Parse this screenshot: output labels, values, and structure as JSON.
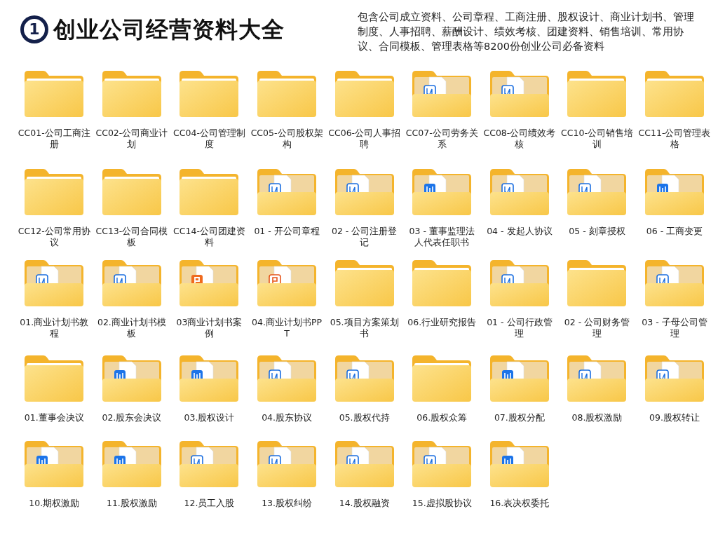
{
  "header": {
    "badge": "1",
    "title": "创业公司经营资料大全",
    "description": "包含公司成立资料、公司章程、工商注册、股权设计、商业计划书、管理制度、人事招聘、薪酬设计、绩效考核、团建资料、销售培训、常用协议、合同模板、管理表格等8200份创业公司必备资料"
  },
  "rows": [
    [
      {
        "name": "CC01-公司工商注册",
        "kind": "empty"
      },
      {
        "name": "CC02-公司商业计划",
        "kind": "empty"
      },
      {
        "name": "CC04-公司管理制度",
        "kind": "empty"
      },
      {
        "name": "CC05-公司股权架构",
        "kind": "empty"
      },
      {
        "name": "CC06-公司人事招聘",
        "kind": "empty"
      },
      {
        "name": "CC07-公司劳务关系",
        "kind": "doc-outline"
      },
      {
        "name": "CC08-公司绩效考核",
        "kind": "doc-outline"
      },
      {
        "name": "CC10-公司销售培训",
        "kind": "empty"
      },
      {
        "name": "CC11-公司管理表格",
        "kind": "empty"
      }
    ],
    [
      {
        "name": "CC12-公司常用协议",
        "kind": "empty"
      },
      {
        "name": "CC13-公司合同模板",
        "kind": "empty"
      },
      {
        "name": "CC14-公司团建资料",
        "kind": "empty"
      },
      {
        "name": "01 - 开公司章程",
        "kind": "doc-outline"
      },
      {
        "name": "02 - 公司注册登记",
        "kind": "doc-outline"
      },
      {
        "name": "03 - 董事监理法人代表任职书",
        "kind": "doc-filled"
      },
      {
        "name": "04 - 发起人协议",
        "kind": "doc-outline"
      },
      {
        "name": "05 - 刻章授权",
        "kind": "doc-outline"
      },
      {
        "name": "06 - 工商变更",
        "kind": "doc-filled"
      }
    ],
    [
      {
        "name": "01.商业计划书教程",
        "kind": "doc-outline"
      },
      {
        "name": "02.商业计划书模板",
        "kind": "doc-outline"
      },
      {
        "name": "03商业计划书案例",
        "kind": "slide-filled"
      },
      {
        "name": "04.商业计划书PPT",
        "kind": "slide-outline"
      },
      {
        "name": "05.项目方案策划书",
        "kind": "empty"
      },
      {
        "name": "06.行业研究报告",
        "kind": "empty"
      },
      {
        "name": "01 - 公司行政管理",
        "kind": "doc-outline"
      },
      {
        "name": "02 - 公司财务管理",
        "kind": "empty"
      },
      {
        "name": "03 - 子母公司管理",
        "kind": "doc-outline"
      }
    ],
    [
      {
        "name": "01.董事会决议",
        "kind": "empty"
      },
      {
        "name": "02.股东会决议",
        "kind": "doc-filled"
      },
      {
        "name": "03.股权设计",
        "kind": "doc-filled"
      },
      {
        "name": "04.股东协议",
        "kind": "doc-outline"
      },
      {
        "name": "05.股权代持",
        "kind": "doc-outline"
      },
      {
        "name": "06.股权众筹",
        "kind": "empty"
      },
      {
        "name": "07.股权分配",
        "kind": "doc-filled"
      },
      {
        "name": "08.股权激励",
        "kind": "doc-outline"
      },
      {
        "name": "09.股权转让",
        "kind": "doc-outline"
      }
    ],
    [
      {
        "name": "10.期权激励",
        "kind": "doc-filled"
      },
      {
        "name": "11.股权激励",
        "kind": "doc-filled"
      },
      {
        "name": "12.员工入股",
        "kind": "doc-outline"
      },
      {
        "name": "13.股权纠纷",
        "kind": "doc-outline"
      },
      {
        "name": "14.股权融资",
        "kind": "doc-outline"
      },
      {
        "name": "15.虚拟股协议",
        "kind": "doc-outline"
      },
      {
        "name": "16.表决权委托",
        "kind": "doc-filled"
      }
    ]
  ]
}
